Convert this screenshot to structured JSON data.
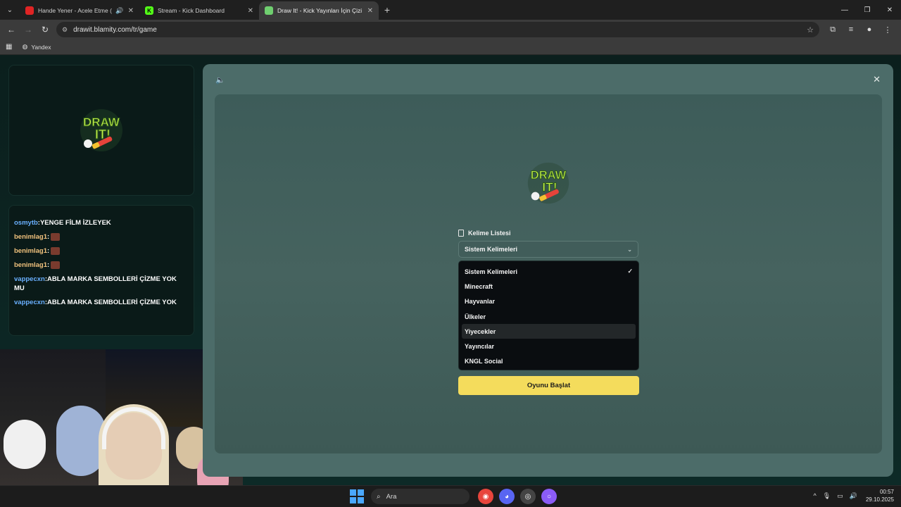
{
  "browser": {
    "tabs": [
      {
        "title": "Hande Yener - Acele Etme (",
        "favicon_color": "#e02424",
        "muted_icon": "speaker-icon",
        "active": false
      },
      {
        "title": "Stream - Kick Dashboard",
        "favicon_color": "#53fc18",
        "favicon_letter": "K",
        "active": false
      },
      {
        "title": "Draw It! - Kick Yayınları İçin Çizi",
        "favicon_color": "#6fcf6f",
        "active": true
      }
    ],
    "url": "drawit.blamity.com/tr/game",
    "bookmark_label": "Yandex"
  },
  "chat": {
    "messages": [
      {
        "user": "osmytb",
        "user_color": "#6ab0ff",
        "text": "YENGE FİLM İZLEYEK",
        "emote": false
      },
      {
        "user": "benimlag1",
        "user_color": "#f1c27d",
        "text": "",
        "emote": true
      },
      {
        "user": "benimlag1",
        "user_color": "#f1c27d",
        "text": "",
        "emote": true
      },
      {
        "user": "benimlag1",
        "user_color": "#f1c27d",
        "text": "",
        "emote": true
      },
      {
        "user": "vappecxn",
        "user_color": "#6ab0ff",
        "text": "ABLA MARKA SEMBOLLERİ ÇİZME YOK MU",
        "emote": false
      },
      {
        "user": "vappecxn",
        "user_color": "#6ab0ff",
        "text": "ABLA MARKA SEMBOLLERİ ÇİZME YOK",
        "emote": false
      }
    ]
  },
  "game": {
    "logo_text": "DRAW IT!",
    "word_list_label": "Kelime Listesi",
    "selected": "Sistem Kelimeleri",
    "options": [
      {
        "label": "Sistem Kelimeleri",
        "checked": true,
        "hover": false
      },
      {
        "label": "Minecraft",
        "checked": false,
        "hover": false
      },
      {
        "label": "Hayvanlar",
        "checked": false,
        "hover": false
      },
      {
        "label": "Ülkeler",
        "checked": false,
        "hover": false
      },
      {
        "label": "Yiyecekler",
        "checked": false,
        "hover": true
      },
      {
        "label": "Yayıncılar",
        "checked": false,
        "hover": false
      },
      {
        "label": "KNGL Social",
        "checked": false,
        "hover": false
      }
    ],
    "start_button": "Oyunu Başlat",
    "accent": "#f4dc5c"
  },
  "taskbar": {
    "search_label": "Ara",
    "time": "00:57",
    "date": "29.10.2025"
  }
}
